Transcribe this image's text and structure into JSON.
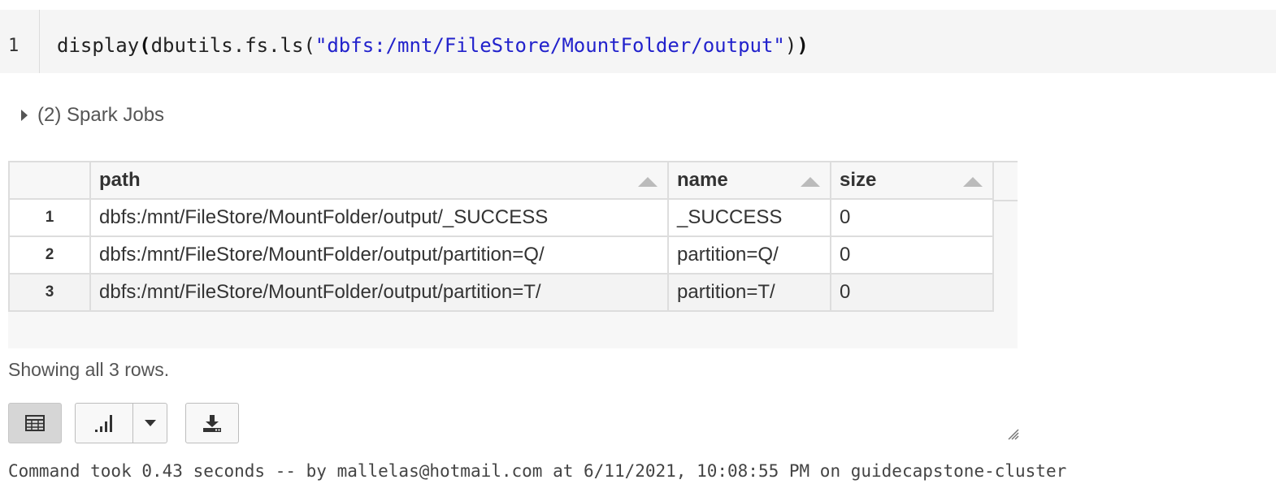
{
  "code_cell": {
    "line_number": "1",
    "fn_prefix": "display",
    "open_paren": "(",
    "call": "dbutils.fs.ls(",
    "string_literal": "\"dbfs:/mnt/FileStore/MountFolder/output\"",
    "close_inner": ")",
    "close_outer": ")"
  },
  "spark_jobs": {
    "label": "(2) Spark Jobs"
  },
  "table": {
    "columns": [
      "path",
      "name",
      "size"
    ],
    "rows": [
      {
        "index": "1",
        "path": "dbfs:/mnt/FileStore/MountFolder/output/_SUCCESS",
        "name": "_SUCCESS",
        "size": "0"
      },
      {
        "index": "2",
        "path": "dbfs:/mnt/FileStore/MountFolder/output/partition=Q/",
        "name": "partition=Q/",
        "size": "0"
      },
      {
        "index": "3",
        "path": "dbfs:/mnt/FileStore/MountFolder/output/partition=T/",
        "name": "partition=T/",
        "size": "0"
      }
    ]
  },
  "footer": {
    "showing": "Showing all 3 rows.",
    "status": "Command took 0.43 seconds -- by mallelas@hotmail.com at 6/11/2021, 10:08:55 PM on guidecapstone-cluster"
  },
  "toolbar": {
    "table_icon": "table-icon",
    "chart_icon": "bar-chart-icon",
    "dropdown_icon": "chevron-down-icon",
    "download_icon": "download-icon"
  },
  "colors": {
    "string": "#2222cc",
    "code_bg": "#f5f5f5",
    "active_button": "#d6d6d6"
  }
}
